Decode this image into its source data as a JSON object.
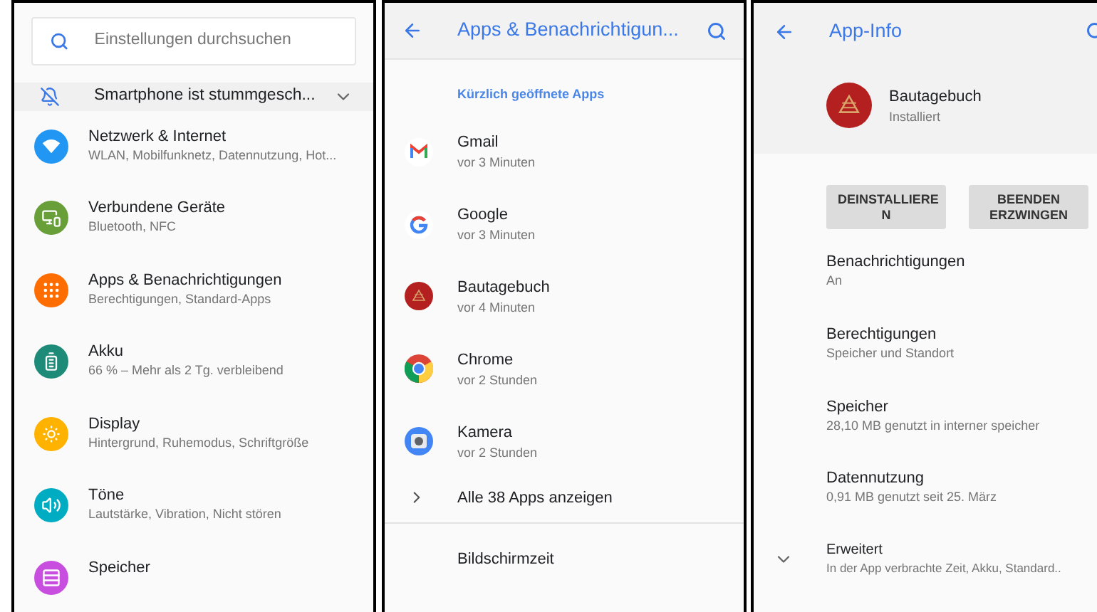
{
  "settings_panel": {
    "search": {
      "placeholder": "Einstellungen durchsuchen"
    },
    "silent_banner": {
      "text": "Smartphone ist stummgesch...",
      "expanded": false
    },
    "items": [
      {
        "title": "Netzwerk & Internet",
        "subtitle": "WLAN, Mobilfunknetz, Datennutzung, Hot...",
        "color": "#2196f3"
      },
      {
        "title": "Verbundene Geräte",
        "subtitle": "Bluetooth, NFC",
        "color": "#689f38"
      },
      {
        "title": "Apps & Benachrichtigungen",
        "subtitle": "Berechtigungen, Standard-Apps",
        "color": "#ff6d00"
      },
      {
        "title": "Akku",
        "subtitle": "66 % – Mehr als 2 Tg. verbleibend",
        "color": "#1e8a78"
      },
      {
        "title": "Display",
        "subtitle": "Hintergrund, Ruhemodus, Schriftgröße",
        "color": "#ffb300"
      },
      {
        "title": "Töne",
        "subtitle": "Lautstärke, Vibration, Nicht stören",
        "color": "#00acc1"
      },
      {
        "title": "Speicher",
        "color": "#c84ee0"
      }
    ]
  },
  "apps_panel": {
    "title": "Apps & Benachrichtigun...",
    "section": "Kürzlich geöffnete Apps",
    "apps": [
      {
        "name": "Gmail",
        "time": "vor 3 Minuten"
      },
      {
        "name": "Google",
        "time": "vor 3 Minuten"
      },
      {
        "name": "Bautagebuch",
        "time": "vor 4 Minuten"
      },
      {
        "name": "Chrome",
        "time": "vor 2 Stunden"
      },
      {
        "name": "Kamera",
        "time": "vor 2 Stunden"
      }
    ],
    "all_apps": "Alle 38 Apps anzeigen",
    "screen_time": "Bildschirmzeit"
  },
  "app_info_panel": {
    "title": "App-Info",
    "app": {
      "name": "Bautagebuch",
      "status": "Installiert"
    },
    "buttons": [
      "DEINSTALLIERE N",
      "BEENDEN ERZWINGEN"
    ],
    "items": [
      {
        "title": "Benachrichtigungen",
        "subtitle": "An"
      },
      {
        "title": "Berechtigungen",
        "subtitle": "Speicher und Standort"
      },
      {
        "title": "Speicher",
        "subtitle": "28,10 MB genutzt in interner speicher"
      },
      {
        "title": "Datennutzung",
        "subtitle": "0,91 MB genutzt seit 25. März"
      }
    ],
    "advanced": {
      "title": "Erweitert",
      "subtitle": "In der App verbrachte Zeit, Akku, Standard..",
      "expanded": false
    }
  }
}
